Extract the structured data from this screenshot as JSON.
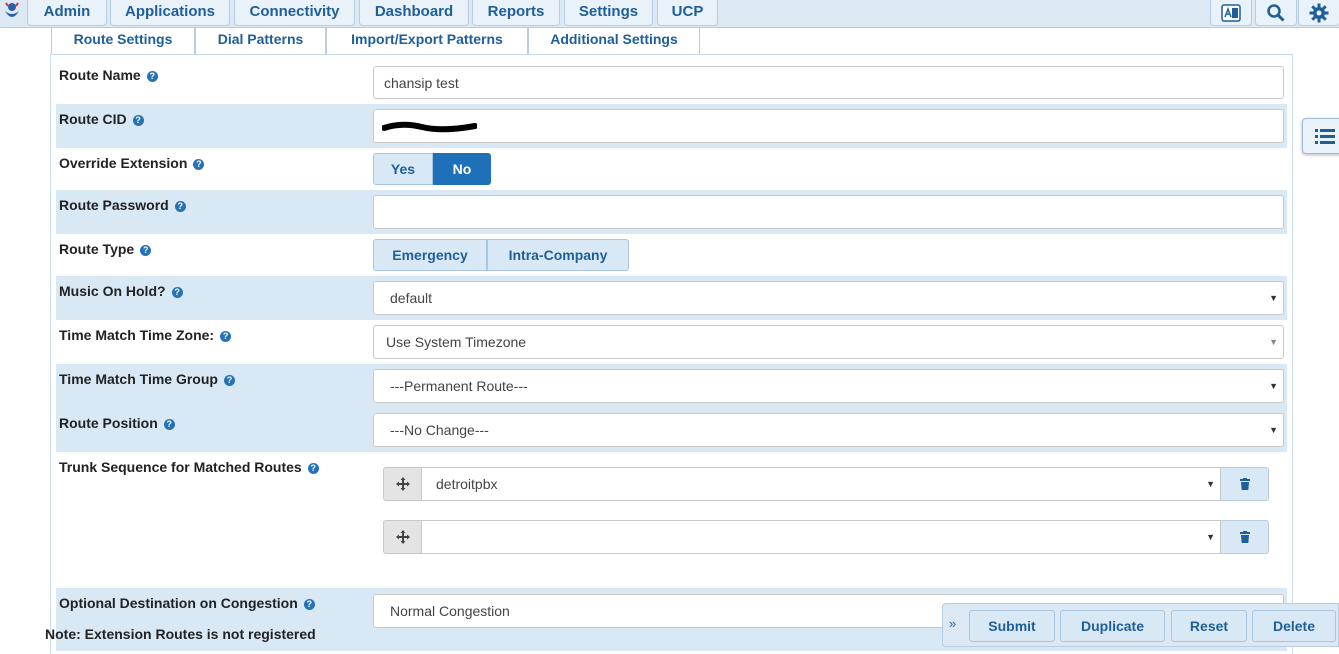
{
  "top_nav": {
    "items": [
      "Admin",
      "Applications",
      "Connectivity",
      "Dashboard",
      "Reports",
      "Settings",
      "UCP"
    ],
    "icons": [
      "language-icon",
      "search-icon",
      "gear-icon"
    ]
  },
  "sub_tabs": [
    "Route Settings",
    "Dial Patterns",
    "Import/Export Patterns",
    "Additional Settings"
  ],
  "active_sub_tab": "Route Settings",
  "form": {
    "route_name": {
      "label": "Route Name",
      "value": "chansip test"
    },
    "route_cid": {
      "label": "Route CID",
      "value": ""
    },
    "override_extension": {
      "label": "Override Extension",
      "options": [
        "Yes",
        "No"
      ],
      "selected": "No"
    },
    "route_password": {
      "label": "Route Password",
      "value": ""
    },
    "route_type": {
      "label": "Route Type",
      "options": [
        "Emergency",
        "Intra-Company"
      ]
    },
    "music_on_hold": {
      "label": "Music On Hold?",
      "value": "default"
    },
    "time_zone": {
      "label": "Time Match Time Zone:",
      "value": "Use System Timezone"
    },
    "time_group": {
      "label": "Time Match Time Group",
      "value": "---Permanent Route---"
    },
    "route_position": {
      "label": "Route Position",
      "value": "---No Change---"
    },
    "trunk_sequence": {
      "label": "Trunk Sequence for Matched Routes",
      "trunks": [
        "detroitpbx",
        ""
      ]
    },
    "congestion": {
      "label": "Optional Destination on Congestion",
      "value": "Normal Congestion"
    }
  },
  "note": "Note: Extension Routes is not registered",
  "actions": [
    "Submit",
    "Duplicate",
    "Reset",
    "Delete"
  ],
  "colors": {
    "accent": "#1e71b8",
    "nav_bg": "#dce8f3",
    "row_shade": "#d9e8f5",
    "link": "#1f5f99"
  }
}
